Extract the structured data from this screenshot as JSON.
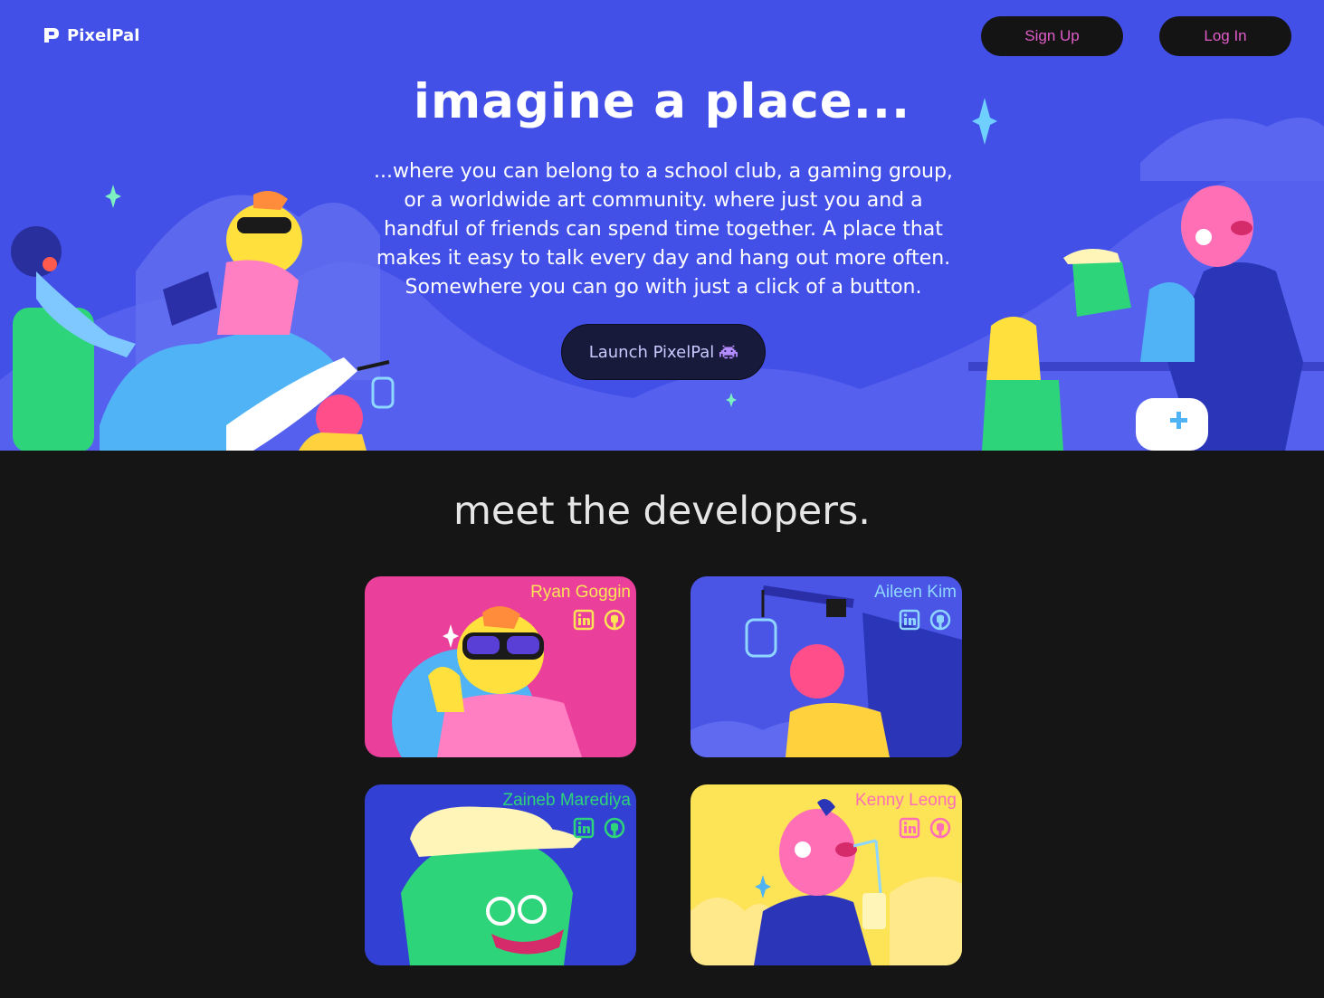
{
  "header": {
    "brand": "PixelPal",
    "signup_label": "Sign Up",
    "login_label": "Log In"
  },
  "hero": {
    "headline": "imagine a place...",
    "description": "...where you can belong to a school club, a gaming group, or a worldwide art community. where just you and a handful of friends can spend time together. A place that makes it easy to talk every day and hang out more often. Somewhere you can go with just a click of a button.",
    "launch_label": "Launch PixelPal",
    "launch_icon": "alien-invader-icon"
  },
  "developers": {
    "title": "meet the developers.",
    "cards": [
      {
        "name": "Ryan Goggin",
        "name_color": "#fde356",
        "bg": "#ea3f9b",
        "icon_color": "#fde356"
      },
      {
        "name": "Aileen Kim",
        "name_color": "#8fd6ff",
        "bg": "#4a55e6",
        "icon_color": "#8fd6ff"
      },
      {
        "name": "Zaineb Marediya",
        "name_color": "#2ed47a",
        "bg": "#3340d4",
        "icon_color": "#2ed47a"
      },
      {
        "name": "Kenny Leong",
        "name_color": "#ff6fb6",
        "bg": "#fde356",
        "icon_color": "#ff6fb6"
      }
    ]
  },
  "colors": {
    "hero_bg": "#4350e8",
    "page_bg": "#151515",
    "nav_text": "#e05cc8"
  }
}
